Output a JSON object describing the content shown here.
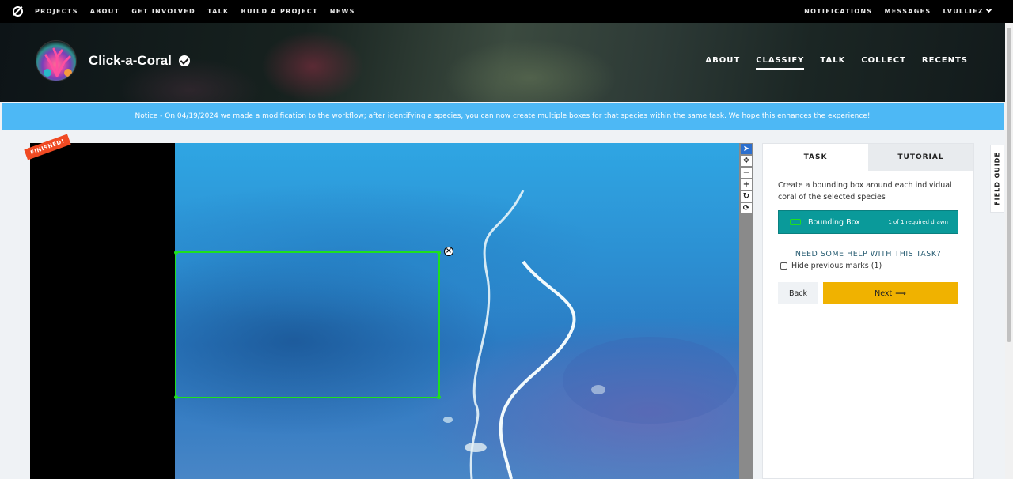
{
  "top_nav": {
    "links": [
      "PROJECTS",
      "ABOUT",
      "GET INVOLVED",
      "TALK",
      "BUILD A PROJECT",
      "NEWS"
    ],
    "right": {
      "notifications": "NOTIFICATIONS",
      "messages": "MESSAGES",
      "user": "LVULLIEZ"
    }
  },
  "project": {
    "title": "Click-a-Coral",
    "nav": [
      "ABOUT",
      "CLASSIFY",
      "TALK",
      "COLLECT",
      "RECENTS"
    ],
    "active_nav": "CLASSIFY"
  },
  "notice": "Notice - On 04/19/2024 we made a modification to the workflow; after identifying a species, you can now create multiple boxes for that species within the same task. We hope this enhances the experience!",
  "viewer": {
    "badge": "FINISHED!",
    "toolbar": [
      "pointer-icon",
      "move-icon",
      "zoom-out-icon",
      "zoom-in-icon",
      "rotate-icon",
      "reset-icon"
    ]
  },
  "task_panel": {
    "tabs": {
      "task": "TASK",
      "tutorial": "TUTORIAL"
    },
    "instruction": "Create a bounding box around each individual coral of the selected species",
    "tool": {
      "name": "Bounding Box",
      "count": "1 of 1 required drawn",
      "color": "#1ee01e"
    },
    "help": "NEED SOME HELP WITH THIS TASK?",
    "hide_marks": "Hide previous marks (1)",
    "back": "Back",
    "next": "Next"
  },
  "field_guide": "FIELD GUIDE",
  "colors": {
    "notice": "#4db8f5",
    "next": "#f0b200",
    "tool": "#0a9a9a",
    "badge": "#f04a23"
  }
}
